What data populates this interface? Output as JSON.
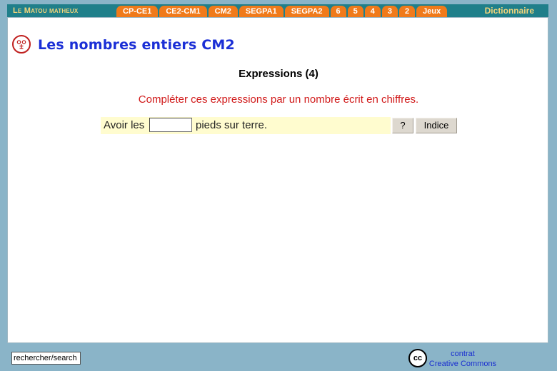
{
  "nav": {
    "brand": "Le Matou matheux",
    "tabs": [
      "CP-CE1",
      "CE2-CM1",
      "CM2",
      "SEGPA1",
      "SEGPA2",
      "6",
      "5",
      "4",
      "3",
      "2",
      "Jeux"
    ],
    "dictionary": "Dictionnaire"
  },
  "page": {
    "title": "Les nombres entiers CM2",
    "exercise_title": "Expressions (4)",
    "instruction": "Compléter ces expressions par un nombre écrit en chiffres."
  },
  "exercise": {
    "before": "Avoir les",
    "answer_value": "",
    "after": "pieds sur terre.",
    "help_button": "?",
    "hint_button": "Indice"
  },
  "footer": {
    "search_value": "rechercher/search",
    "cc_icon": "cc",
    "license_line1": "contrat",
    "license_line2": "Creative Commons"
  },
  "colors": {
    "background": "#8ab4c8",
    "nav_bar": "#1f7f8a",
    "tab": "#f07a1a",
    "title_blue": "#1b2fd6",
    "instruction_red": "#d11a1a",
    "answer_row": "#fffccf"
  }
}
